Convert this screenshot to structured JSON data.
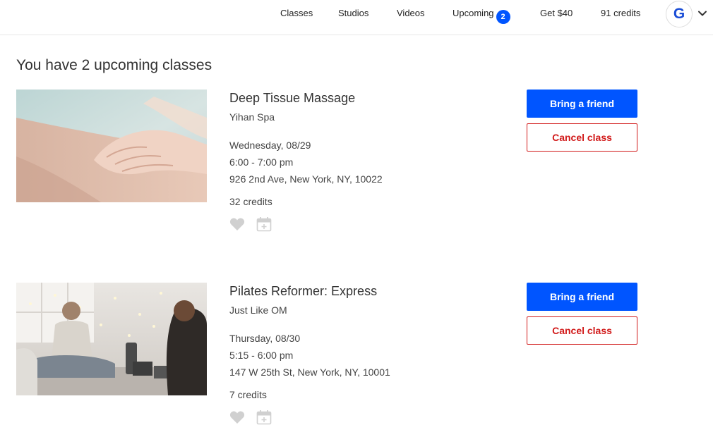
{
  "nav": {
    "classes": "Classes",
    "studios": "Studios",
    "videos": "Videos",
    "upcoming": "Upcoming",
    "upcoming_count": "2",
    "referral": "Get $40",
    "credits": "91 credits",
    "avatar_letter": "G"
  },
  "page": {
    "title": "You have 2 upcoming classes"
  },
  "classes": [
    {
      "name": "Deep Tissue Massage",
      "studio": "Yihan Spa",
      "date": "Wednesday, 08/29",
      "time": "6:00 - 7:00 pm",
      "address": "926 2nd Ave, New York, NY, 10022",
      "credits": "32 credits",
      "bring_friend_label": "Bring a friend",
      "cancel_label": "Cancel class",
      "image_subject": "massage-photo"
    },
    {
      "name": "Pilates Reformer: Express",
      "studio": "Just Like OM",
      "date": "Thursday, 08/30",
      "time": "5:15 - 6:00 pm",
      "address": "147 W 25th St, New York, NY, 10001",
      "credits": "7 credits",
      "bring_friend_label": "Bring a friend",
      "cancel_label": "Cancel class",
      "image_subject": "yoga-class-photo"
    }
  ],
  "icons": {
    "favorite": "heart-icon",
    "calendar": "calendar-add-icon",
    "account_menu": "chevron-down-icon"
  },
  "colors": {
    "primary": "#0055ff",
    "danger": "#d11a1a",
    "text": "#333333",
    "icon_muted": "#d0d0d0"
  }
}
